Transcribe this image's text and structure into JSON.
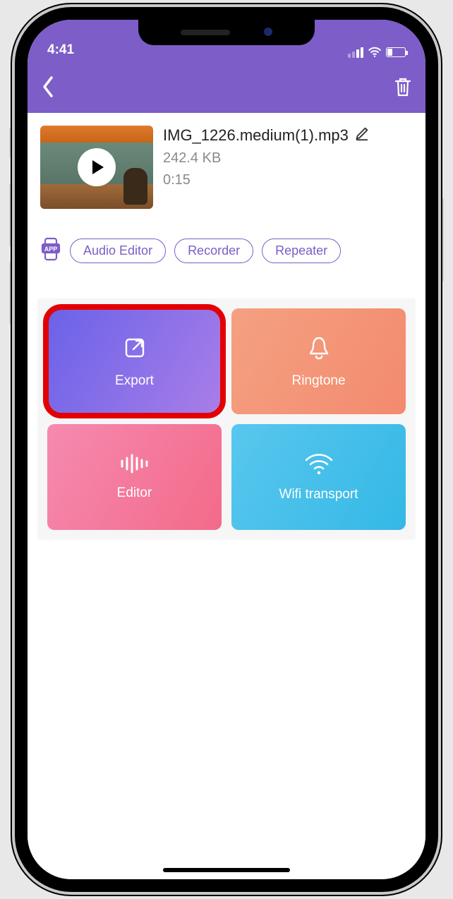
{
  "status": {
    "time": "4:41"
  },
  "file": {
    "name": "IMG_1226.medium(1).mp3",
    "size": "242.4 KB",
    "duration": "0:15"
  },
  "chips": {
    "audio_editor": "Audio Editor",
    "recorder": "Recorder",
    "repeater": "Repeater"
  },
  "tiles": {
    "export": "Export",
    "ringtone": "Ringtone",
    "editor": "Editor",
    "wifi": "Wifi transport"
  },
  "highlight": "export"
}
